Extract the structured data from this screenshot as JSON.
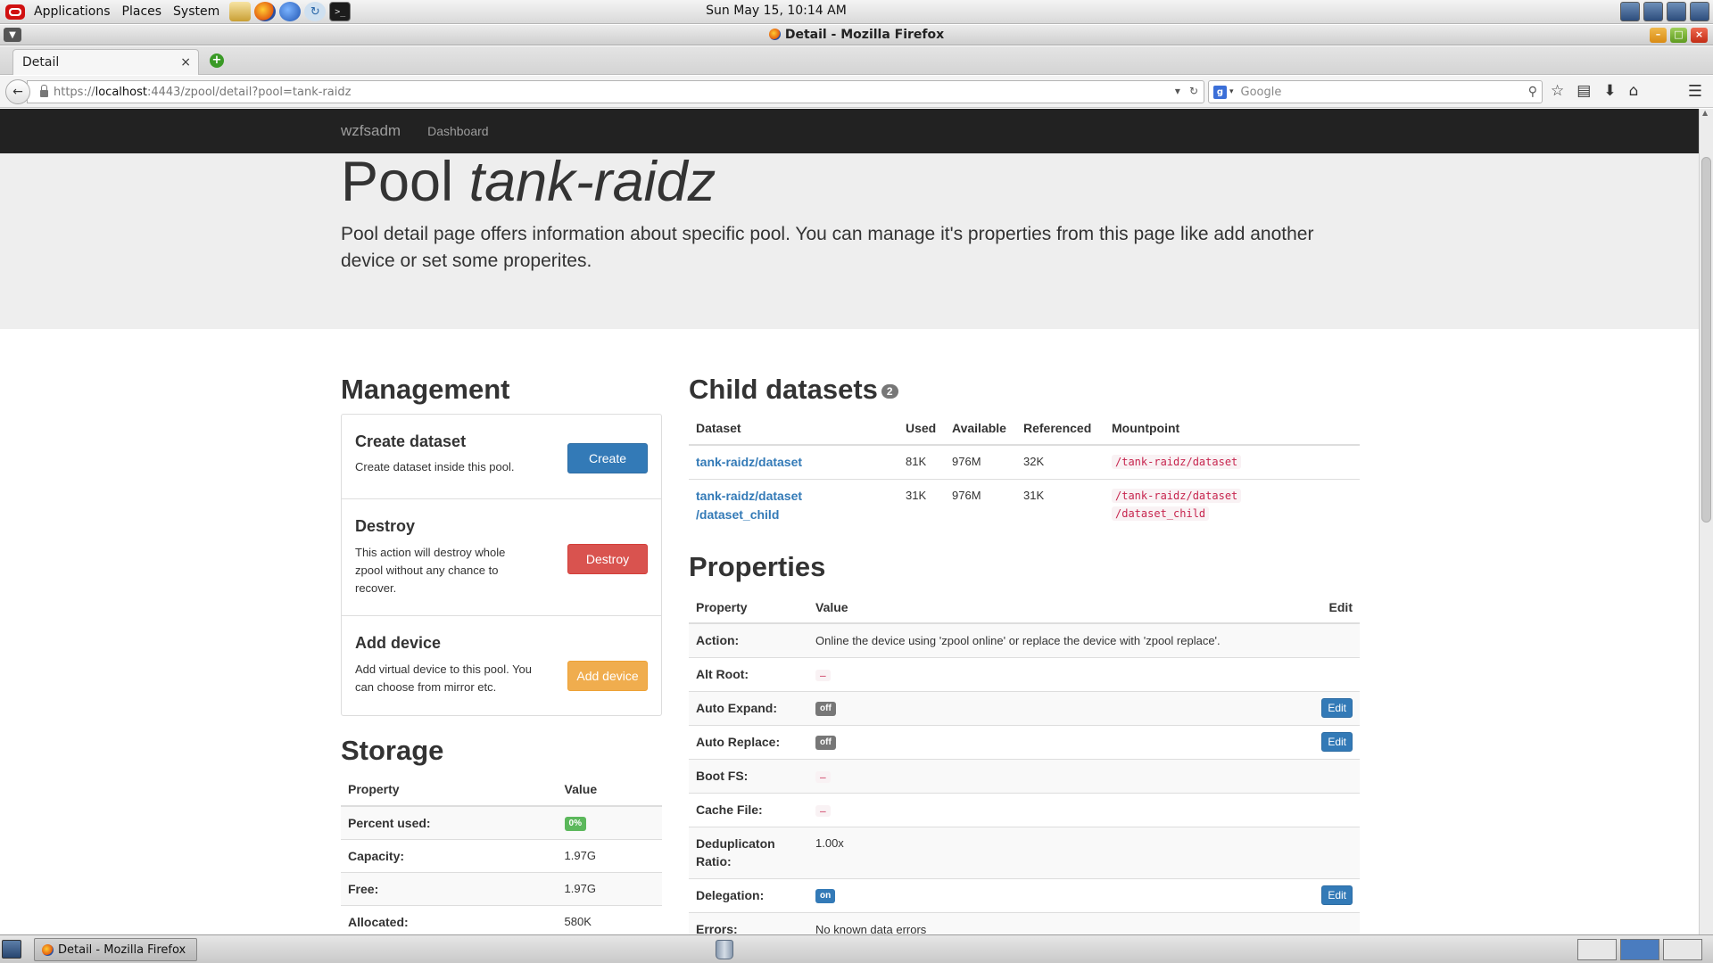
{
  "os_panel": {
    "menus": [
      "Applications",
      "Places",
      "System"
    ],
    "clock": "Sun May 15, 10:14 AM"
  },
  "window": {
    "title": "Detail - Mozilla Firefox"
  },
  "browser": {
    "tab_title": "Detail",
    "tab_close": "×",
    "new_tab": "+",
    "url_scheme": "https://",
    "url_host": "localhost",
    "url_rest": ":4443/zpool/detail?pool=tank-raidz",
    "search_placeholder": "Google",
    "search_engine_icon": "g"
  },
  "site_nav": {
    "brand": "wzfsadm",
    "links": [
      "Dashboard"
    ]
  },
  "jumbotron": {
    "title_prefix": "Pool",
    "title_pool": "tank-raidz",
    "lead": "Pool detail page offers information about specific pool. You can manage it's properties from this page like add another device or set some properites."
  },
  "management": {
    "heading": "Management",
    "items": [
      {
        "title": "Create dataset",
        "description": "Create dataset inside this pool.",
        "button": "Create"
      },
      {
        "title": "Destroy",
        "description": "This action will destroy whole zpool without any chance to recover.",
        "button": "Destroy"
      },
      {
        "title": "Add device",
        "description": "Add virtual device to this pool. You can choose from mirror etc.",
        "button": "Add device"
      }
    ]
  },
  "storage": {
    "heading": "Storage",
    "columns": [
      "Property",
      "Value"
    ],
    "rows": [
      {
        "key": "Percent used:",
        "value": "0%"
      },
      {
        "key": "Capacity:",
        "value": "1.97G"
      },
      {
        "key": "Free:",
        "value": "1.97G"
      },
      {
        "key": "Allocated:",
        "value": "580K"
      }
    ]
  },
  "child_datasets": {
    "heading": "Child datasets",
    "count": "2",
    "columns": [
      "Dataset",
      "Used",
      "Available",
      "Referenced",
      "Mountpoint"
    ],
    "rows": [
      {
        "dataset_line1": "tank-raidz/dataset",
        "dataset_line2": "",
        "used": "81K",
        "available": "976M",
        "referenced": "32K",
        "mount_line1": "/tank-raidz/dataset",
        "mount_line2": ""
      },
      {
        "dataset_line1": "tank-raidz/dataset",
        "dataset_line2": "/dataset_child",
        "used": "31K",
        "available": "976M",
        "referenced": "31K",
        "mount_line1": "/tank-raidz/dataset",
        "mount_line2": "/dataset_child"
      }
    ]
  },
  "properties": {
    "heading": "Properties",
    "columns": [
      "Property",
      "Value",
      "Edit"
    ],
    "rows": [
      {
        "key": "Action:",
        "value": "Online the device using 'zpool online' or replace the device with 'zpool replace'."
      },
      {
        "key": "Alt Root:",
        "value": "–"
      },
      {
        "key": "Auto Expand:",
        "value": "off",
        "edit": "Edit"
      },
      {
        "key": "Auto Replace:",
        "value": "off",
        "edit": "Edit"
      },
      {
        "key": "Boot FS:",
        "value": "–"
      },
      {
        "key": "Cache File:",
        "value": "–"
      },
      {
        "key_line1": "Deduplicaton",
        "key_line2": "Ratio:",
        "value": "1.00x"
      },
      {
        "key": "Delegation:",
        "value": "on",
        "edit": "Edit"
      },
      {
        "key": "Errors:",
        "value": "No known data errors"
      }
    ]
  },
  "taskbar": {
    "task_title": "Detail - Mozilla Firefox"
  }
}
